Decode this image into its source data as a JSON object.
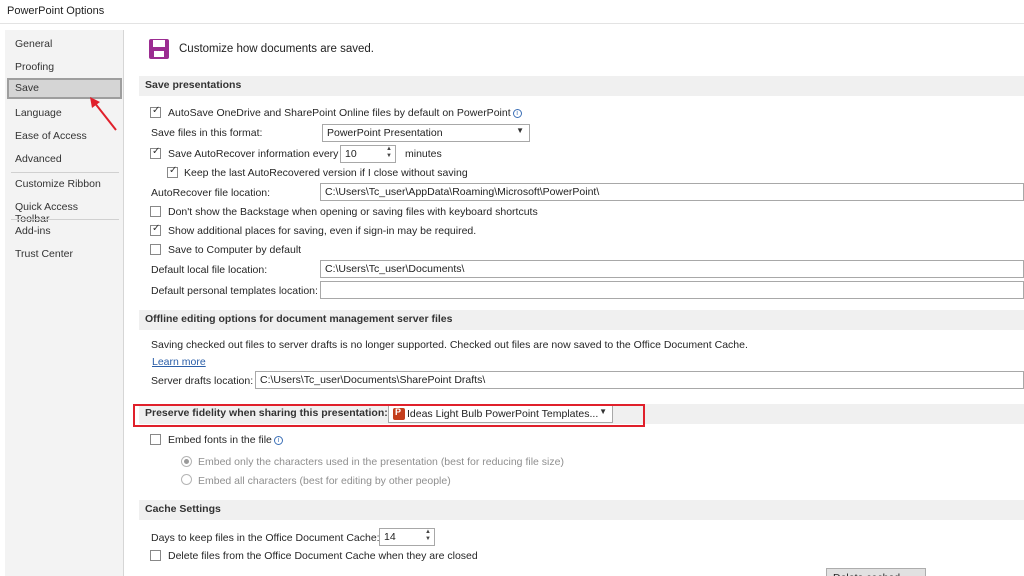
{
  "window": {
    "title": "PowerPoint Options"
  },
  "sidebar": {
    "items": [
      {
        "label": "General"
      },
      {
        "label": "Proofing"
      },
      {
        "label": "Save"
      },
      {
        "label": "Language"
      },
      {
        "label": "Ease of Access"
      },
      {
        "label": "Advanced"
      },
      {
        "label": "Customize Ribbon"
      },
      {
        "label": "Quick Access Toolbar"
      },
      {
        "label": "Add-ins"
      },
      {
        "label": "Trust Center"
      }
    ],
    "selected": "Save"
  },
  "header": {
    "text": "Customize how documents are saved."
  },
  "save_presentations": {
    "heading": "Save presentations",
    "autosave_label": "AutoSave OneDrive and SharePoint Online files by default on PowerPoint",
    "autosave_checked": true,
    "format_label": "Save files in this format:",
    "format_value": "PowerPoint Presentation",
    "autorecover_label": "Save AutoRecover information every",
    "autorecover_checked": true,
    "autorecover_minutes": "10",
    "minutes_label": "minutes",
    "keep_last_label": "Keep the last AutoRecovered version if I close without saving",
    "keep_last_checked": true,
    "autorecover_location_label": "AutoRecover file location:",
    "autorecover_location_value": "C:\\Users\\Tc_user\\AppData\\Roaming\\Microsoft\\PowerPoint\\",
    "dont_show_backstage_label": "Don't show the Backstage when opening or saving files with keyboard shortcuts",
    "dont_show_backstage_checked": false,
    "show_additional_label": "Show additional places for saving, even if sign-in may be required.",
    "show_additional_checked": true,
    "save_to_computer_label": "Save to Computer by default",
    "save_to_computer_checked": false,
    "default_local_label": "Default local file location:",
    "default_local_value": "C:\\Users\\Tc_user\\Documents\\",
    "default_templates_label": "Default personal templates location:",
    "default_templates_value": ""
  },
  "offline_editing": {
    "heading": "Offline editing options for document management server files",
    "notice": "Saving checked out files to server drafts is no longer supported. Checked out files are now saved to the Office Document Cache.",
    "learn_more": "Learn more",
    "server_drafts_label": "Server drafts location:",
    "server_drafts_value": "C:\\Users\\Tc_user\\Documents\\SharePoint Drafts\\"
  },
  "fidelity": {
    "label": "Preserve fidelity when sharing this presentation:",
    "value": "Ideas Light Bulb PowerPoint Templates...",
    "embed_fonts_label": "Embed fonts in the file",
    "embed_fonts_checked": false,
    "embed_only_label": "Embed only the characters used in the presentation (best for reducing file size)",
    "embed_only_checked": true,
    "embed_all_label": "Embed all characters (best for editing by other people)",
    "embed_all_checked": false
  },
  "cache": {
    "heading": "Cache Settings",
    "days_label": "Days to keep files in the Office Document Cache:",
    "days_value": "14",
    "delete_label": "Delete files from the Office Document Cache when they are closed",
    "delete_checked": false,
    "delete_button_label": "Delete cached Files"
  },
  "colors": {
    "annotation_red": "#e0202b",
    "save_icon": "#9b2c91",
    "link": "#2a5ea8"
  }
}
